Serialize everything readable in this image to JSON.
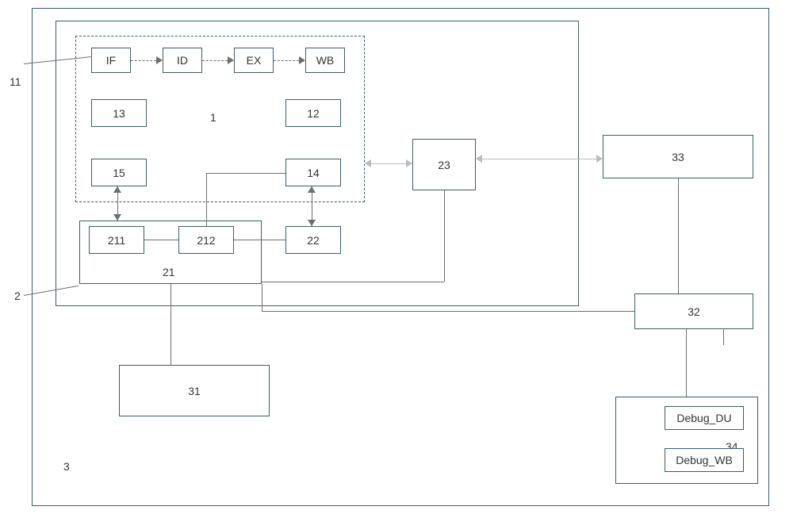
{
  "outer": {
    "label": "3"
  },
  "middle": {
    "label": "2"
  },
  "outside_label": "11",
  "block1": {
    "label": "1",
    "pipeline": [
      "IF",
      "ID",
      "EX",
      "WB"
    ],
    "cells": {
      "c12": "12",
      "c13": "13",
      "c14": "14",
      "c15": "15"
    }
  },
  "block21": {
    "label": "21",
    "c211": "211",
    "c212": "212"
  },
  "c22": "22",
  "c23": "23",
  "c31": "31",
  "c32": "32",
  "c33": "33",
  "block34": {
    "label": "34",
    "du": "Debug_DU",
    "wb": "Debug_WB"
  }
}
